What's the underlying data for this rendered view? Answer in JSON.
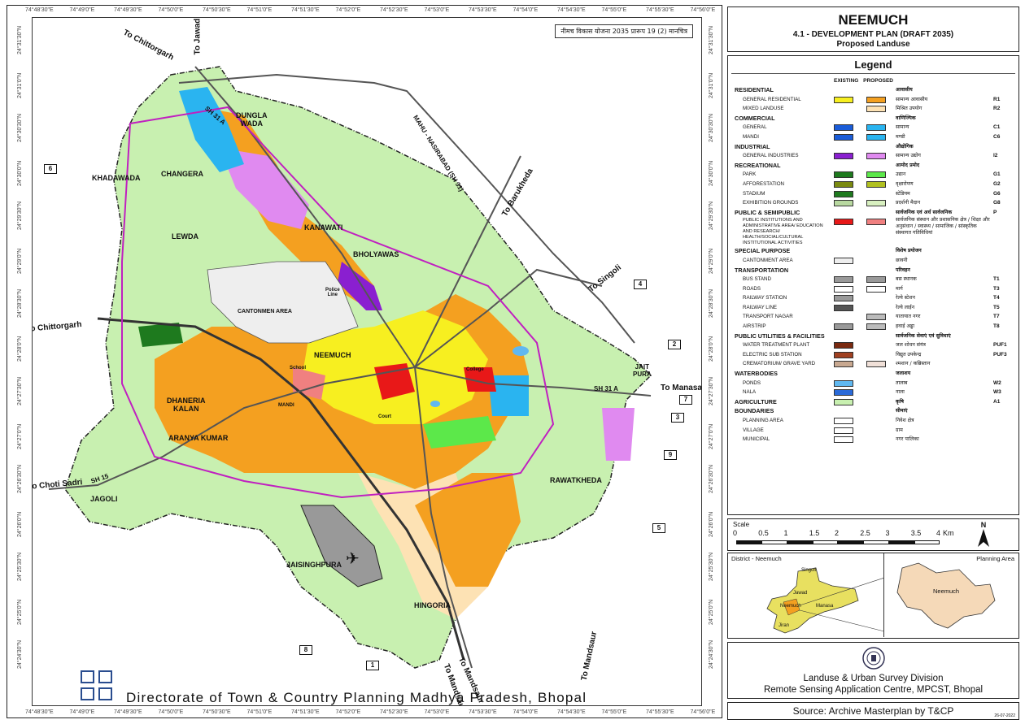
{
  "map": {
    "hindi_title": "नीमच विकास योजना 2035 प्रारूप 19 (2) मानचित्र",
    "coords_top": [
      "74°48'30\"E",
      "74°49'0\"E",
      "74°49'30\"E",
      "74°50'0\"E",
      "74°50'30\"E",
      "74°51'0\"E",
      "74°51'30\"E",
      "74°52'0\"E",
      "74°52'30\"E",
      "74°53'0\"E",
      "74°53'30\"E",
      "74°54'0\"E",
      "74°54'30\"E",
      "74°55'0\"E",
      "74°55'30\"E",
      "74°56'0\"E"
    ],
    "coords_side": [
      "24°31'30\"N",
      "24°31'0\"N",
      "24°30'30\"N",
      "24°30'0\"N",
      "24°29'30\"N",
      "24°29'0\"N",
      "24°28'30\"N",
      "24°28'0\"N",
      "24°27'30\"N",
      "24°27'0\"N",
      "24°26'30\"N",
      "24°26'0\"N",
      "24°25'30\"N",
      "24°25'0\"N",
      "24°24'30\"N"
    ],
    "places": {
      "dungla_wada": "DUNGLA\nWADA",
      "khadawada": "KHADAWADA",
      "changera": "CHANGERA",
      "kanawati": "KANAWATI",
      "lewda": "LEWDA",
      "bholyawas": "BHOLYAWAS",
      "cantonment": "CANTONMEN AREA",
      "police_line": "Police\nLine",
      "neemuch": "NEEMUCH",
      "school": "School",
      "dhaneria_kalan": "DHANERIA\nKALAN",
      "aranya_kumar": "ARANYA KUMAR",
      "jagoli": "JAGOLI",
      "jaisinghpura": "JAISINGHPURA",
      "hingoria": "HINGORIA",
      "rawatkheda": "RAWATKHEDA",
      "jait_pura": "JAIT\nPURA",
      "college": "College",
      "court": "Court",
      "mandi": "MANDI"
    },
    "roads": {
      "to_chittorgarh_n": "To Chittorgarh",
      "to_jawad": "To Jawad",
      "sh31a_n": "SH 31 A",
      "mahu": "MAHU - NASIRABAD (SH 31)",
      "to_barukheda": "To Barukheda",
      "to_singoli": "To Singoli",
      "to_chittorgarh_w": "To Chittorgarh",
      "to_manasa": "To Manasa",
      "sh31a_e": "SH 31 A",
      "to_choti_sadri": "To Choti Sadri",
      "sh15": "SH 15",
      "to_mandsaur_1": "To Mandsaur",
      "to_mandsaur_2": "To Mandsaur",
      "to_mandsaur_3": "To Mandsaur"
    },
    "callouts": [
      "1",
      "2",
      "3",
      "4",
      "5",
      "6",
      "7",
      "8",
      "9"
    ],
    "footer": "Directorate of Town & Country Planning Madhya Pradesh, Bhopal"
  },
  "title": {
    "name": "NEEMUCH",
    "plan": "4.1 - DEVELOPMENT PLAN (DRAFT 2035)",
    "sub": "Proposed Landuse"
  },
  "legend": {
    "heading": "Legend",
    "col_existing": "EXISTING",
    "col_proposed": "PROPOSED",
    "rows": [
      {
        "type": "cat",
        "en": "RESIDENTIAL",
        "hi": "आवासीय",
        "code": ""
      },
      {
        "type": "sub",
        "en": "GENERAL RESIDENTIAL",
        "hi": "सामान्य आवासीय",
        "code": "R1",
        "a": "#f7ef20",
        "b": "#f4a020"
      },
      {
        "type": "sub",
        "en": "MIXED LANDUSE",
        "hi": "मिश्रित उपयोग",
        "code": "R2",
        "b": "#fde2b4"
      },
      {
        "type": "cat",
        "en": "COMMERCIAL",
        "hi": "वाणिज्यिक",
        "code": ""
      },
      {
        "type": "sub",
        "en": "GENERAL",
        "hi": "सामान्य",
        "code": "C1",
        "a": "#1a5cd8",
        "b": "#2ab4f0"
      },
      {
        "type": "sub",
        "en": "MANDI",
        "hi": "मण्डी",
        "code": "C6",
        "a": "#1a5cd8",
        "b": "#2ab4f0"
      },
      {
        "type": "cat",
        "en": "INDUSTRIAL",
        "hi": "औद्योगिक",
        "code": ""
      },
      {
        "type": "sub",
        "en": "GENERAL INDUSTRIES",
        "hi": "सामान्य उद्योग",
        "code": "I2",
        "a": "#8a1fd0",
        "b": "#e08af0"
      },
      {
        "type": "cat",
        "en": "RECREATIONAL",
        "hi": "आमोद प्रमोद",
        "code": ""
      },
      {
        "type": "sub",
        "en": "PARK",
        "hi": "उद्यान",
        "code": "G1",
        "a": "#1e7a1e",
        "b": "#5ce84a"
      },
      {
        "type": "sub",
        "en": "AFFORESTATION",
        "hi": "वृक्षारोपण",
        "code": "G2",
        "a": "#7a8a10",
        "b": "#b0c020"
      },
      {
        "type": "sub",
        "en": "STADIUM",
        "hi": "स्टेडियम",
        "code": "G6",
        "a": "#1e7a1e"
      },
      {
        "type": "sub",
        "en": "EXHIBITION GROUNDS",
        "hi": "प्रदर्शनी मैदान",
        "code": "G8",
        "a": "#b8d8a0",
        "b": "#d8f0c0"
      },
      {
        "type": "cat",
        "en": "PUBLIC & SEMIPUBLIC",
        "hi": "सार्वजनिक एवं अर्ध सार्वजनिक",
        "code": "P"
      },
      {
        "type": "tall",
        "en": "PUBLIC INSTITUTIONS AND ADMINISTRATIVE AREA/ EDUCATION AND RESEARCH/ HEALTH/SOCIAL/CULTURAL INSTITUTIONAL ACTIVITIES",
        "hi": "सार्वजनिक संस्थान और प्रशासनिक क्षेत्र / शिक्षा और अनुसंधान / स्वास्थ्य / सामाजिक / सांस्कृतिक संस्थागत गतिविधियां",
        "code": "",
        "a": "#e81818",
        "b": "#f08080"
      },
      {
        "type": "cat",
        "en": "SPECIAL PURPOSE",
        "hi": "विशेष प्रयोजन",
        "code": ""
      },
      {
        "type": "sub",
        "en": "CANTONMENT AREA",
        "hi": "छावनी",
        "code": "",
        "a": "#eeeeee"
      },
      {
        "type": "cat",
        "en": "TRANSPORTATION",
        "hi": "परिवहन",
        "code": ""
      },
      {
        "type": "sub",
        "en": "BUS STAND",
        "hi": "बस स्थानक",
        "code": "T1",
        "a": "#999999",
        "b": "#999999"
      },
      {
        "type": "sub",
        "en": "ROADS",
        "hi": "मार्ग",
        "code": "T3",
        "a": "#ffffff",
        "b": "#ffffff"
      },
      {
        "type": "sub",
        "en": "RAILWAY STATION",
        "hi": "रेल्वे स्टेशन",
        "code": "T4",
        "a": "#999999"
      },
      {
        "type": "sub",
        "en": "RAILWAY LINE",
        "hi": "रेल्वे लाईन",
        "code": "T5",
        "a": "#555555"
      },
      {
        "type": "sub",
        "en": "TRANSPORT NAGAR",
        "hi": "यातायात नगर",
        "code": "T7",
        "b": "#bbbbbb"
      },
      {
        "type": "sub",
        "en": "AIRSTRIP",
        "hi": "हवाई अड्डा",
        "code": "T8",
        "a": "#999999",
        "b": "#bbbbbb"
      },
      {
        "type": "cat",
        "en": "PUBLIC UTILITIES & FACILITIES",
        "hi": "सार्वजनिक सेवाएं एवं सुविधाएं",
        "code": ""
      },
      {
        "type": "sub",
        "en": "WATER TREATMENT PLANT",
        "hi": "जल शोधन संयंत्र",
        "code": "PUF1",
        "a": "#7a2a10"
      },
      {
        "type": "sub",
        "en": "ELECTRIC SUB STATION",
        "hi": "विद्युत उपकेन्द्र",
        "code": "PUF3",
        "a": "#a04020"
      },
      {
        "type": "sub",
        "en": "CREMATORIUM/ GRAVE YARD",
        "hi": "श्मशान / कब्रिस्तान",
        "code": "",
        "a": "#c8a890",
        "b": "#f0e0d8"
      },
      {
        "type": "cat",
        "en": "WATERBODIES",
        "hi": "जलाशय",
        "code": ""
      },
      {
        "type": "sub",
        "en": "PONDS",
        "hi": "तालाब",
        "code": "W2",
        "a": "#60b8f0"
      },
      {
        "type": "sub",
        "en": "NALA",
        "hi": "नाला",
        "code": "W3",
        "a": "#2a6ad8"
      },
      {
        "type": "cat",
        "en": "AGRICULTURE",
        "hi": "कृषि",
        "code": "A1",
        "a": "#c8f0b0"
      },
      {
        "type": "cat",
        "en": "BOUNDARIES",
        "hi": "सीमाएं",
        "code": ""
      },
      {
        "type": "sub",
        "en": "PLANNING AREA",
        "hi": "निवेश क्षेत्र",
        "code": "",
        "a": "#ffffff"
      },
      {
        "type": "sub",
        "en": "VILLAGE",
        "hi": "ग्राम",
        "code": "",
        "a": "#ffffff"
      },
      {
        "type": "sub",
        "en": "MUNICIPAL",
        "hi": "नगर पालिका",
        "code": "",
        "a": "#ffffff"
      }
    ]
  },
  "scale": {
    "title": "Scale",
    "ticks": [
      "0",
      "0.5",
      "1",
      "1.5",
      "2",
      "2.5",
      "3",
      "3.5",
      "4"
    ],
    "unit": "Km",
    "north": "N"
  },
  "locator": {
    "left_title": "District - Neemuch",
    "right_title": "Planning Area",
    "towns": [
      "Singoli",
      "Jawad",
      "Neemuch",
      "Manasa",
      "Jiran"
    ],
    "right_label": "Neemuch"
  },
  "credit": {
    "line1": "Landuse & Urban Survey Division",
    "line2": "Remote Sensing Application Centre, MPCST, Bhopal"
  },
  "source": "Source: Archive Masterplan by T&CP",
  "date": "26-07-2022"
}
